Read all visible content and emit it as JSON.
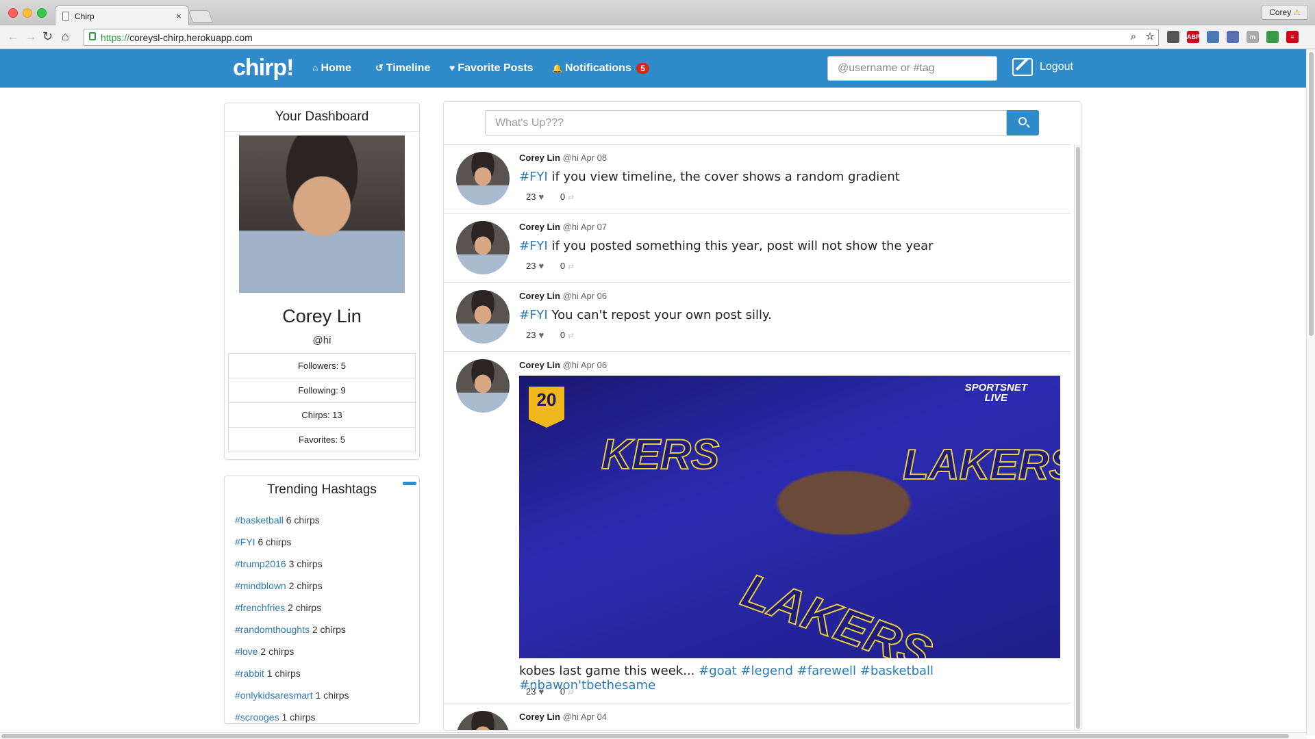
{
  "browser": {
    "tab_title": "Chirp",
    "tab_close": "×",
    "url_scheme": "https://",
    "url_rest": "coreysl-chirp.herokuapp.com",
    "profile_name": "Corey",
    "profile_warning": "⚠",
    "back": "←",
    "forward": "→",
    "reload": "↻",
    "home": "⌂",
    "extensions": [
      {
        "name": "magnify-icon",
        "label": "⌕",
        "color": "#777777"
      },
      {
        "name": "star-icon",
        "label": "☆",
        "color": "#777777"
      },
      {
        "name": "pocket-icon",
        "label": "",
        "color": "#555555"
      },
      {
        "name": "adblock-icon",
        "label": "ABP",
        "color": "#d0021b"
      },
      {
        "name": "cast-icon",
        "label": "",
        "color": "#4a7bb5"
      },
      {
        "name": "calendar-icon",
        "label": "",
        "color": "#5b6fb5"
      },
      {
        "name": "m-icon",
        "label": "m",
        "color": "#aaaaaa"
      },
      {
        "name": "now-icon",
        "label": "",
        "color": "#3a9a4a"
      },
      {
        "name": "menu-icon",
        "label": "≡",
        "color": "#d0021b"
      }
    ]
  },
  "nav": {
    "brand": "chirp!",
    "home": "Home",
    "timeline": "Timeline",
    "favorites": "Favorite Posts",
    "notifications": "Notifications",
    "notification_count": "5",
    "search_placeholder": "@username or #tag",
    "logout": "Logout"
  },
  "dashboard": {
    "title": "Your Dashboard",
    "name": "Corey Lin",
    "handle": "@hi",
    "stats": [
      "Followers: 5",
      "Following: 9",
      "Chirps: 13",
      "Favorites: 5"
    ]
  },
  "trending": {
    "title": "Trending Hashtags",
    "items": [
      {
        "tag": "#basketball",
        "count": "6 chirps"
      },
      {
        "tag": "#FYI",
        "count": "6 chirps"
      },
      {
        "tag": "#trump2016",
        "count": "3 chirps"
      },
      {
        "tag": "#mindblown",
        "count": "2 chirps"
      },
      {
        "tag": "#frenchfries",
        "count": "2 chirps"
      },
      {
        "tag": "#randomthoughts",
        "count": "2 chirps"
      },
      {
        "tag": "#love",
        "count": "2 chirps"
      },
      {
        "tag": "#rabbit",
        "count": "1 chirps"
      },
      {
        "tag": "#onlykidsaresmart",
        "count": "1 chirps"
      },
      {
        "tag": "#scrooges",
        "count": "1 chirps"
      }
    ]
  },
  "compose": {
    "placeholder": "What's Up???"
  },
  "posts": [
    {
      "author": "Corey Lin",
      "handle": "@hi",
      "date": "Apr 08",
      "hashtag": "#FYI",
      "text": " if you view timeline, the cover shows a random gradient",
      "likes": "23",
      "reposts": "0"
    },
    {
      "author": "Corey Lin",
      "handle": "@hi",
      "date": "Apr 07",
      "hashtag": "#FYI",
      "text": " if you posted something this year, post will not show the year",
      "likes": "23",
      "reposts": "0"
    },
    {
      "author": "Corey Lin",
      "handle": "@hi",
      "date": "Apr 06",
      "hashtag": "#FYI",
      "text": " You can't repost your own post silly.",
      "likes": "23",
      "reposts": "0"
    },
    {
      "author": "Corey Lin",
      "handle": "@hi",
      "date": "Apr 06",
      "text": "kobes last game this week... ",
      "hashtags": [
        "#goat",
        "#legend",
        "#farewell",
        "#basketball",
        "#nbawon'tbethesame"
      ],
      "likes": "23",
      "reposts": "0",
      "image": {
        "badge_number": "20",
        "network": "SPORTSNET",
        "network_sub": "LIVE",
        "jersey_text": "LAKERS",
        "jersey_text_left": "KERS",
        "jersey_text_bottom": "LAKERS"
      }
    },
    {
      "author": "Corey Lin",
      "handle": "@hi",
      "date": "Apr 04"
    }
  ],
  "icons": {
    "heart": "♥",
    "repost": "⇄",
    "home": "⌂",
    "timeline": "↺",
    "favorite": "♥",
    "bell": "🔔"
  }
}
